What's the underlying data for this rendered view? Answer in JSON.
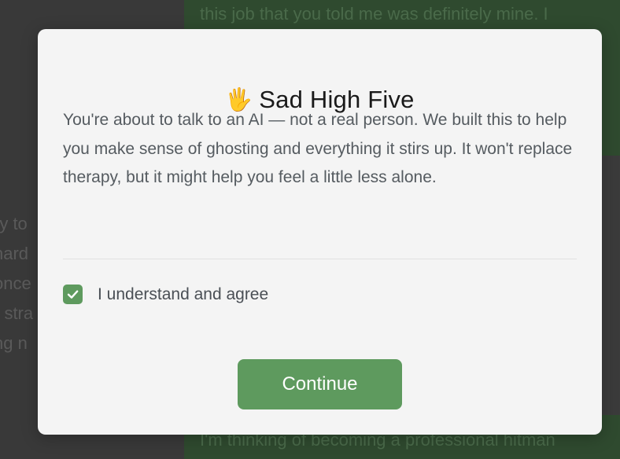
{
  "background": {
    "top_message_lines": [
      "this job that you told me was definitely mine. I",
      "",
      "",
      ""
    ],
    "bottom_message": "I'm thinking of becoming a professional hitman",
    "left_lines": [
      "ry to",
      "hard",
      "once",
      "r stra",
      "ng n"
    ]
  },
  "modal": {
    "title_emoji": "🖐",
    "title": "Sad High Five",
    "body": "You're about to talk to an AI — not a real person. We built this to help you make sense of ghosting and everything it stirs up. It won't replace therapy, but it might help you feel a little less alone.",
    "agree_label": "I understand and agree",
    "agree_checked": true,
    "continue_label": "Continue"
  },
  "colors": {
    "accent": "#5e9a5e",
    "overlay": "#3b3b3b",
    "modal_bg": "#f4f4f4"
  }
}
